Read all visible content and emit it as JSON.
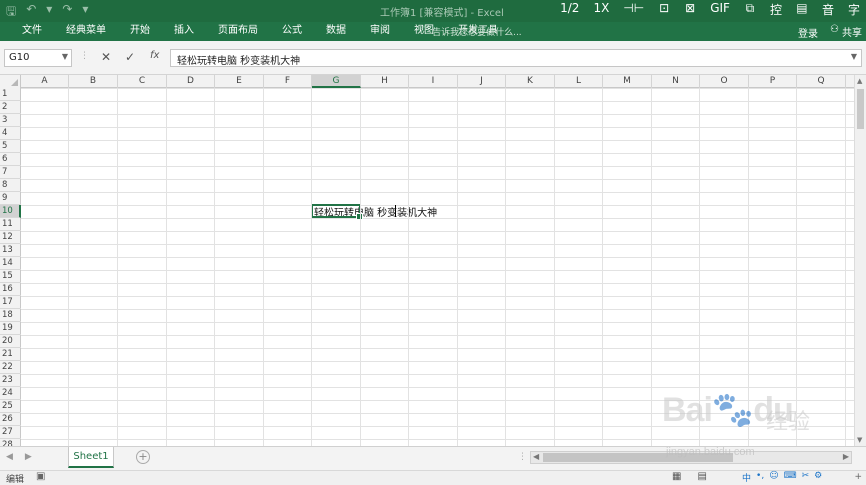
{
  "titlebar": {
    "quick_access": [
      "🖫",
      "↶",
      "▾",
      "↷",
      "▾"
    ],
    "doc_title": "工作簿1 [兼容模式] - Excel",
    "viewer_tools": [
      "1/2",
      "1X",
      "⊣⊢",
      "⊡",
      "⊠",
      "GIF",
      "⧉",
      "控",
      "▤",
      "音",
      "字"
    ]
  },
  "ribbon": {
    "tabs": [
      "文件",
      "经典菜单",
      "开始",
      "插入",
      "页面布局",
      "公式",
      "数据",
      "审阅",
      "视图",
      "开发工具"
    ],
    "tell_me": "告诉我您想要做什么...",
    "login": "登录",
    "share": "共享"
  },
  "formula_bar": {
    "name_box": "G10",
    "cancel": "✕",
    "confirm": "✓",
    "fx": "fx",
    "content": "轻松玩转电脑 秒变装机大神"
  },
  "grid": {
    "columns": [
      "A",
      "B",
      "C",
      "D",
      "E",
      "F",
      "G",
      "H",
      "I",
      "J",
      "K",
      "L",
      "M",
      "N",
      "O",
      "P",
      "Q"
    ],
    "rows": [
      "1",
      "2",
      "3",
      "4",
      "5",
      "6",
      "7",
      "8",
      "9",
      "10",
      "11",
      "12",
      "13",
      "14",
      "15",
      "16",
      "17",
      "18",
      "19",
      "20",
      "21",
      "22",
      "23",
      "24",
      "25",
      "26",
      "27",
      "28"
    ],
    "selected_column": "G",
    "selected_row": "10",
    "cell_text": "轻松玩转电脑 秒变装机大神"
  },
  "sheets": {
    "tabs": [
      "Sheet1"
    ],
    "add": "+"
  },
  "statusbar": {
    "mode": "编辑",
    "ime": [
      "中",
      "•,",
      "☺",
      "⌨",
      "✂",
      "⚙"
    ]
  },
  "watermark": {
    "brand": "Bai",
    "brand2": "du",
    "cn": "经验",
    "url": "jingyan.baidu.com"
  }
}
